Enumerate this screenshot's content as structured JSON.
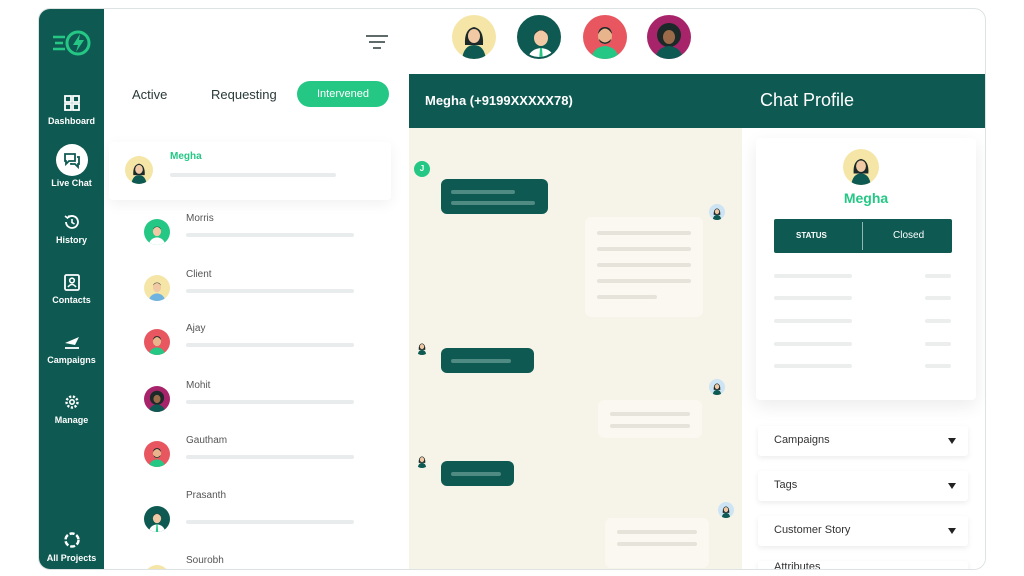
{
  "sidebar": {
    "items": [
      {
        "label": "Dashboard",
        "icon": "dashboard-icon"
      },
      {
        "label": "Live Chat",
        "icon": "chat-icon"
      },
      {
        "label": "History",
        "icon": "history-icon"
      },
      {
        "label": "Contacts",
        "icon": "contacts-icon"
      },
      {
        "label": "Campaigns",
        "icon": "campaigns-icon"
      },
      {
        "label": "Manage",
        "icon": "gear-icon"
      },
      {
        "label": "All Projects",
        "icon": "projects-icon"
      }
    ]
  },
  "tabs": {
    "active": "Active",
    "requesting": "Requesting",
    "intervened": "Intervened"
  },
  "conversations": [
    {
      "name": "Megha"
    },
    {
      "name": "Morris"
    },
    {
      "name": "Client"
    },
    {
      "name": "Ajay"
    },
    {
      "name": "Mohit"
    },
    {
      "name": "Gautham"
    },
    {
      "name": "Prasanth"
    },
    {
      "name": "Sourobh"
    }
  ],
  "chat": {
    "title": "Megha (+9199XXXXX78)",
    "agent_initial": "J"
  },
  "profile": {
    "title": "Chat Profile",
    "name": "Megha",
    "status_label": "STATUS",
    "status_value": "Closed",
    "sections": [
      "Campaigns",
      "Tags",
      "Customer Story",
      "Attributes"
    ]
  },
  "colors": {
    "primary": "#0e5a52",
    "accent": "#25c785",
    "chat_bg": "#f6f3e8"
  }
}
